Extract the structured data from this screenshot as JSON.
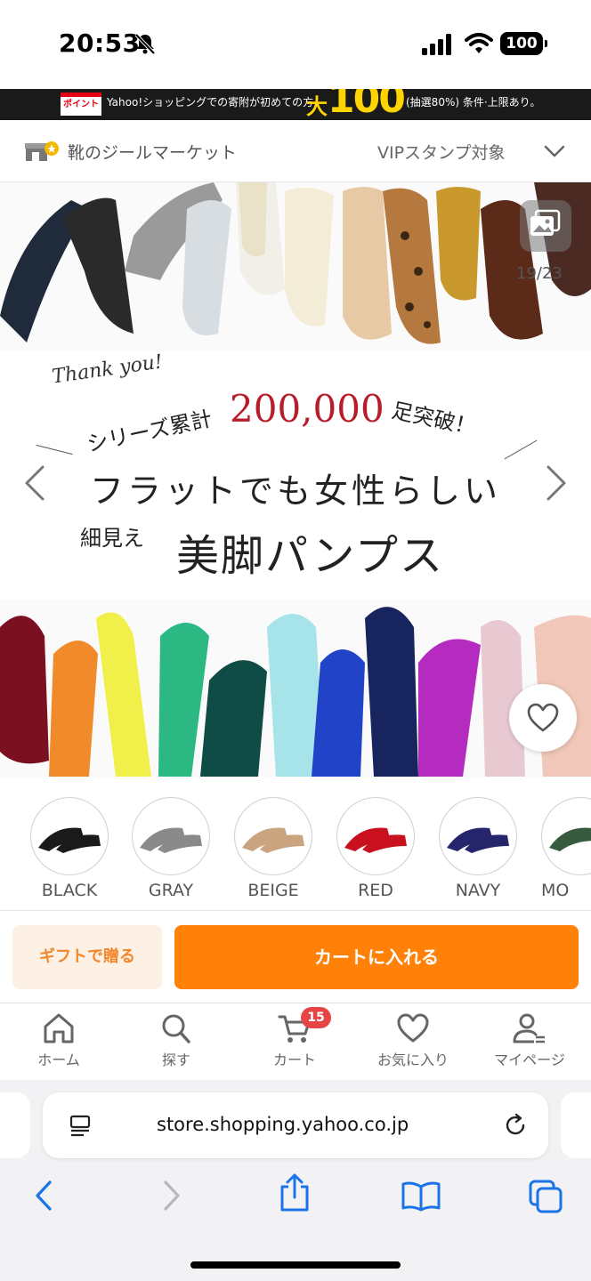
{
  "status_bar": {
    "time": "20:53",
    "battery": "100"
  },
  "promo": {
    "point_label": "ポイント",
    "text": "Yahoo!ショッピングでの寄附が初めての方",
    "daisuu": "大",
    "big": "100",
    "condition": "(抽選80%) 条件·上限あり。"
  },
  "store": {
    "name": "靴のジールマーケット",
    "vip": "VIPスタンプ対象"
  },
  "carousel": {
    "counter": "19/23",
    "thank_you": "Thank you!",
    "series_left": "シリーズ累計",
    "series_number": "200,000",
    "series_right": "足突破！",
    "headline1": "フラットでも女性らしい",
    "headline2_small": "細見え",
    "headline2_big": "美脚パンプス"
  },
  "swatches": [
    {
      "label": "BLACK",
      "color": "#1a1a1a"
    },
    {
      "label": "GRAY",
      "color": "#8a8a8a"
    },
    {
      "label": "BEIGE",
      "color": "#c9a47e"
    },
    {
      "label": "RED",
      "color": "#c8101e"
    },
    {
      "label": "NAVY",
      "color": "#24256b"
    },
    {
      "label": "MO",
      "color": "#355a3e"
    }
  ],
  "actions": {
    "gift": "ギフトで贈る",
    "cart": "カートに入れる"
  },
  "nav": {
    "home": "ホーム",
    "search": "探す",
    "cart": "カート",
    "cart_badge": "15",
    "favorites": "お気に入り",
    "mypage": "マイページ"
  },
  "safari": {
    "url": "store.shopping.yahoo.co.jp"
  },
  "colors": {
    "accent": "#ff8108",
    "gift_bg": "#fdf1e6",
    "badge": "#e64545",
    "ios_blue": "#1a73e8"
  }
}
